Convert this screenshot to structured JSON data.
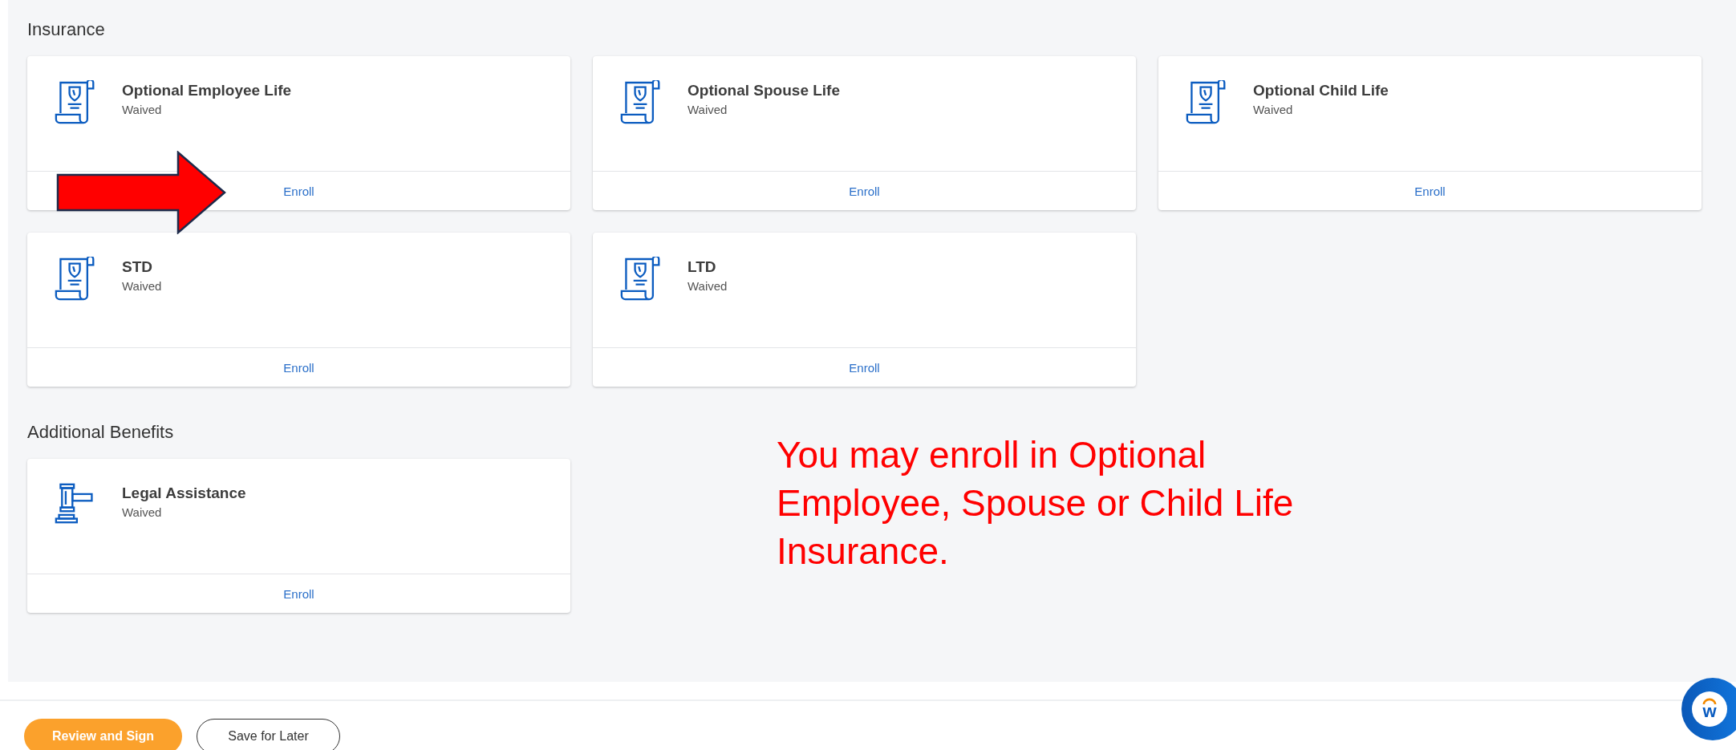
{
  "sections": [
    {
      "title": "Insurance",
      "cards": [
        {
          "kind": "policy",
          "title": "Optional Employee Life",
          "status": "Waived",
          "action": "Enroll"
        },
        {
          "kind": "policy",
          "title": "Optional Spouse Life",
          "status": "Waived",
          "action": "Enroll"
        },
        {
          "kind": "policy",
          "title": "Optional Child Life",
          "status": "Waived",
          "action": "Enroll"
        },
        {
          "kind": "policy",
          "title": "STD",
          "status": "Waived",
          "action": "Enroll"
        },
        {
          "kind": "policy",
          "title": "LTD",
          "status": "Waived",
          "action": "Enroll"
        }
      ]
    },
    {
      "title": "Additional Benefits",
      "cards": [
        {
          "kind": "gavel",
          "title": "Legal Assistance",
          "status": "Waived",
          "action": "Enroll"
        }
      ]
    }
  ],
  "annotation": {
    "text": "You may enroll in Optional Employee, Spouse or Child Life Insurance."
  },
  "buttons": [
    {
      "label": "Review and Sign",
      "kind": "primary"
    },
    {
      "label": "Save for Later",
      "kind": "secondary"
    }
  ],
  "chat_widget": {
    "logo_text": "w"
  }
}
